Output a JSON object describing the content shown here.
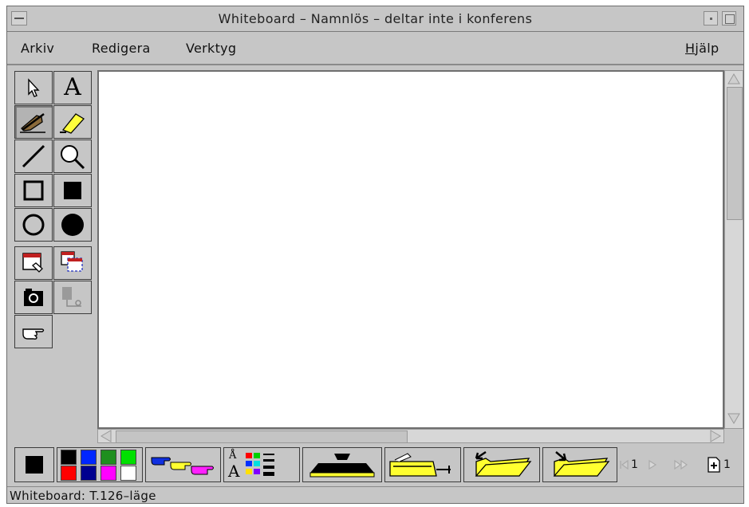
{
  "window": {
    "title": "Whiteboard – Namnlös  – deltar inte i konferens"
  },
  "menu": {
    "arkiv": "Arkiv",
    "redigera": "Redigera",
    "verktyg": "Verktyg",
    "hjalp_h": "H",
    "hjalp_rest": "jälp"
  },
  "tools": {
    "text_glyph": "A",
    "font_glyph_top": "Å",
    "font_glyph_bottom": "A"
  },
  "palette": {
    "colors": [
      "#000000",
      "#0026ff",
      "#1f8f1f",
      "#00e000",
      "#ff0000",
      "#00008f",
      "#ff00ff",
      "#ffffff"
    ],
    "current_color": "#000000",
    "highlighter_color": "#ffff3c"
  },
  "pager": {
    "page_label": "1",
    "total": "1"
  },
  "status": {
    "text": "Whiteboard: T.126–läge"
  }
}
